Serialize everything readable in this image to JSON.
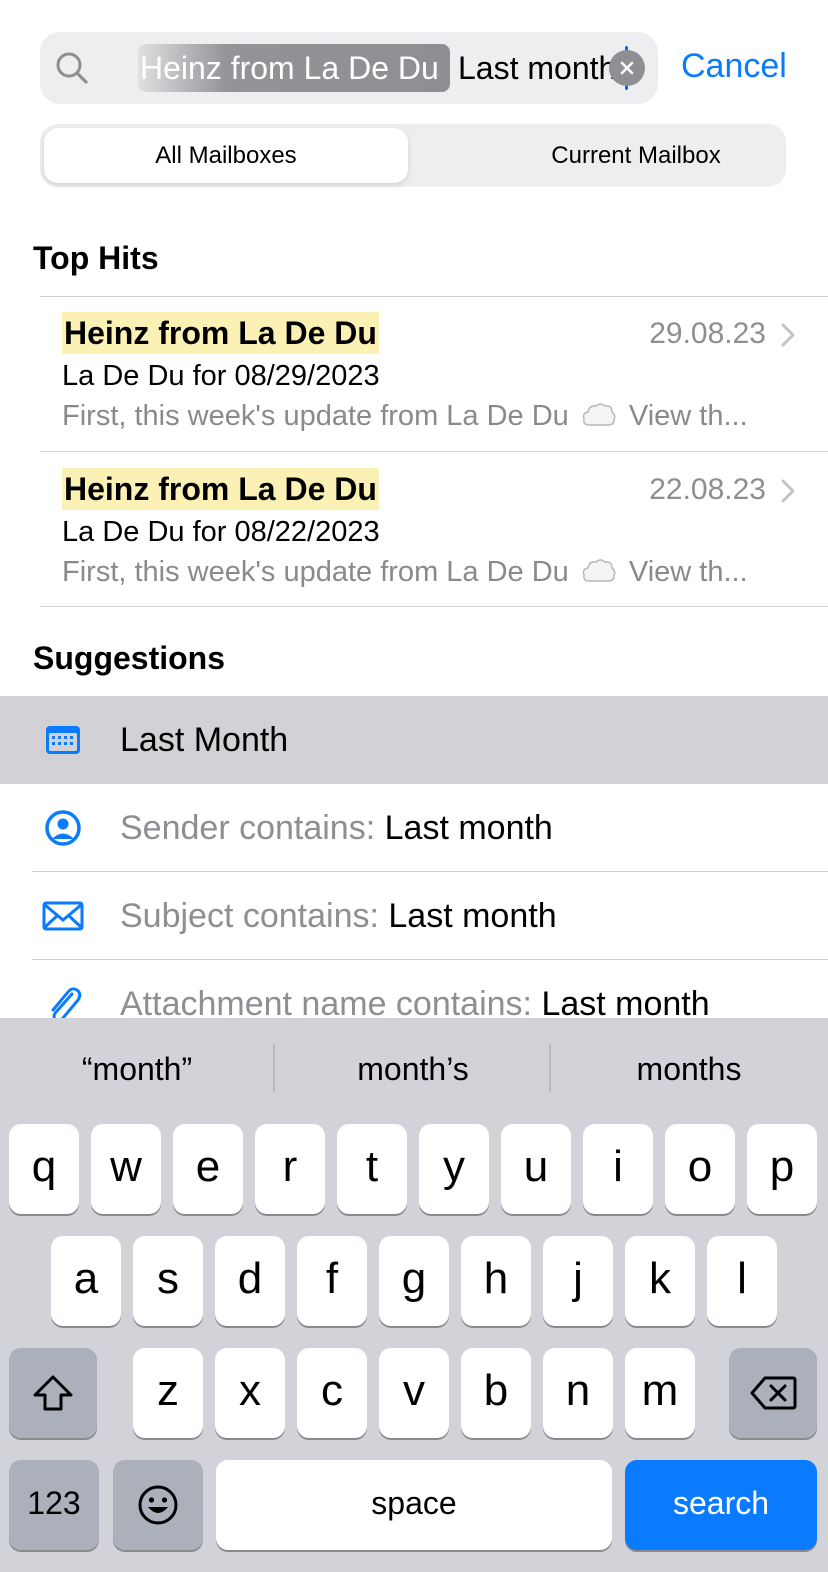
{
  "search": {
    "token": "Heinz from La De Du",
    "query": "Last month",
    "cancel_label": "Cancel"
  },
  "scope": {
    "options": [
      "All Mailboxes",
      "Current Mailbox"
    ],
    "selected": "All Mailboxes"
  },
  "top_hits": {
    "title": "Top Hits",
    "items": [
      {
        "sender": "Heinz from La De Du",
        "date": "29.08.23",
        "subject": "La De Du for 08/29/2023",
        "preview_before": "First, this week's update from La De Du",
        "preview_after": "View th..."
      },
      {
        "sender": "Heinz from La De Du",
        "date": "22.08.23",
        "subject": "La De Du for 08/22/2023",
        "preview_before": "First, this week's update from La De Du",
        "preview_after": "View th..."
      }
    ]
  },
  "suggestions": {
    "title": "Suggestions",
    "items": [
      {
        "icon": "calendar-icon",
        "prefix": "",
        "value": "Last Month"
      },
      {
        "icon": "person-circle-icon",
        "prefix": "Sender contains: ",
        "value": "Last month"
      },
      {
        "icon": "envelope-icon",
        "prefix": "Subject contains: ",
        "value": "Last month"
      },
      {
        "icon": "paperclip-icon",
        "prefix": "Attachment name contains: ",
        "value": "Last month"
      }
    ]
  },
  "keyboard": {
    "predictions": [
      "“month”",
      "month’s",
      "months"
    ],
    "row1": [
      "q",
      "w",
      "e",
      "r",
      "t",
      "y",
      "u",
      "i",
      "o",
      "p"
    ],
    "row2": [
      "a",
      "s",
      "d",
      "f",
      "g",
      "h",
      "j",
      "k",
      "l"
    ],
    "row3": [
      "z",
      "x",
      "c",
      "v",
      "b",
      "n",
      "m"
    ],
    "numbers_label": "123",
    "space_label": "space",
    "search_label": "search"
  },
  "colors": {
    "accent": "#0a7aff",
    "highlight": "#fbf1b4",
    "keyboard_bg": "#d1d3d9"
  }
}
